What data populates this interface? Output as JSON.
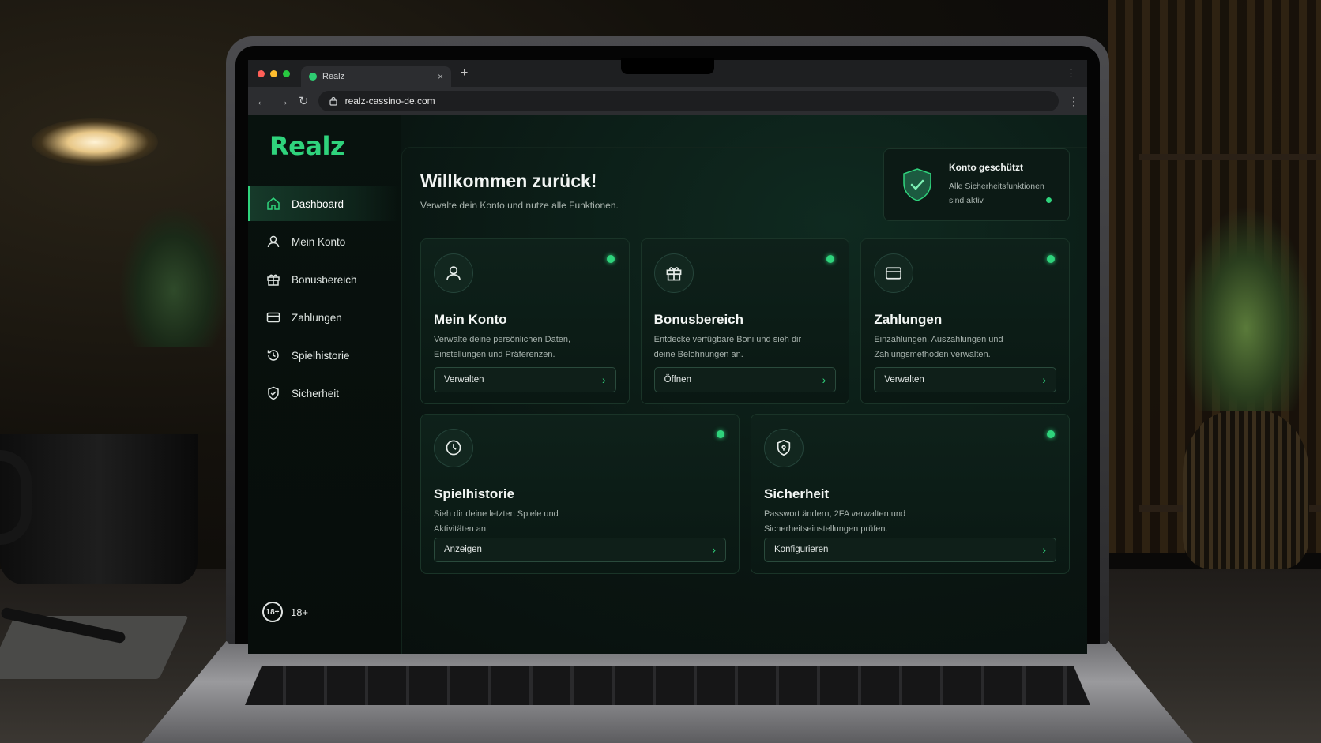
{
  "browser": {
    "tab_title": "Realz",
    "tab_close": "×",
    "new_tab": "+",
    "url": "realz-cassino-de.com",
    "traffic_colors": [
      "#ff5f57",
      "#febc2e",
      "#28c840"
    ]
  },
  "app": {
    "logo": "Realz",
    "accent": "#2fd37c"
  },
  "sidebar": {
    "items": [
      {
        "label": "Dashboard",
        "icon": "home-icon",
        "active": true
      },
      {
        "label": "Mein Konto",
        "icon": "user-icon",
        "active": false
      },
      {
        "label": "Bonusbereich",
        "icon": "gift-icon",
        "active": false
      },
      {
        "label": "Zahlungen",
        "icon": "card-icon",
        "active": false
      },
      {
        "label": "Spielhistorie",
        "icon": "history-icon",
        "active": false
      },
      {
        "label": "Sicherheit",
        "icon": "shield-icon",
        "active": false
      }
    ],
    "age_badge": "18+",
    "age_label": "18+"
  },
  "header": {
    "title": "Willkommen zurück!",
    "subtitle": "Verwalte dein Konto und nutze alle Funktionen."
  },
  "status": {
    "title": "Konto geschützt",
    "description": "Alle Sicherheitsfunktionen sind aktiv."
  },
  "cards": [
    {
      "title": "Mein Konto",
      "description": "Verwalte deine persönlichen Daten, Einstellungen und Präferenzen.",
      "button": "Verwalten",
      "icon": "user-icon"
    },
    {
      "title": "Bonusbereich",
      "description": "Entdecke verfügbare Boni und sieh dir deine Belohnungen an.",
      "button": "Öffnen",
      "icon": "gift-icon"
    },
    {
      "title": "Zahlungen",
      "description": "Einzahlungen, Auszahlungen und Zahlungsmethoden verwalten.",
      "button": "Verwalten",
      "icon": "card-icon"
    },
    {
      "title": "Spielhistorie",
      "description": "Sieh dir deine letzten Spiele und Aktivitäten an.",
      "button": "Anzeigen",
      "icon": "clock-icon"
    },
    {
      "title": "Sicherheit",
      "description": "Passwort ändern, 2FA verwalten und Sicherheitseinstellungen prüfen.",
      "button": "Konfigurieren",
      "icon": "shield-lock-icon"
    }
  ]
}
